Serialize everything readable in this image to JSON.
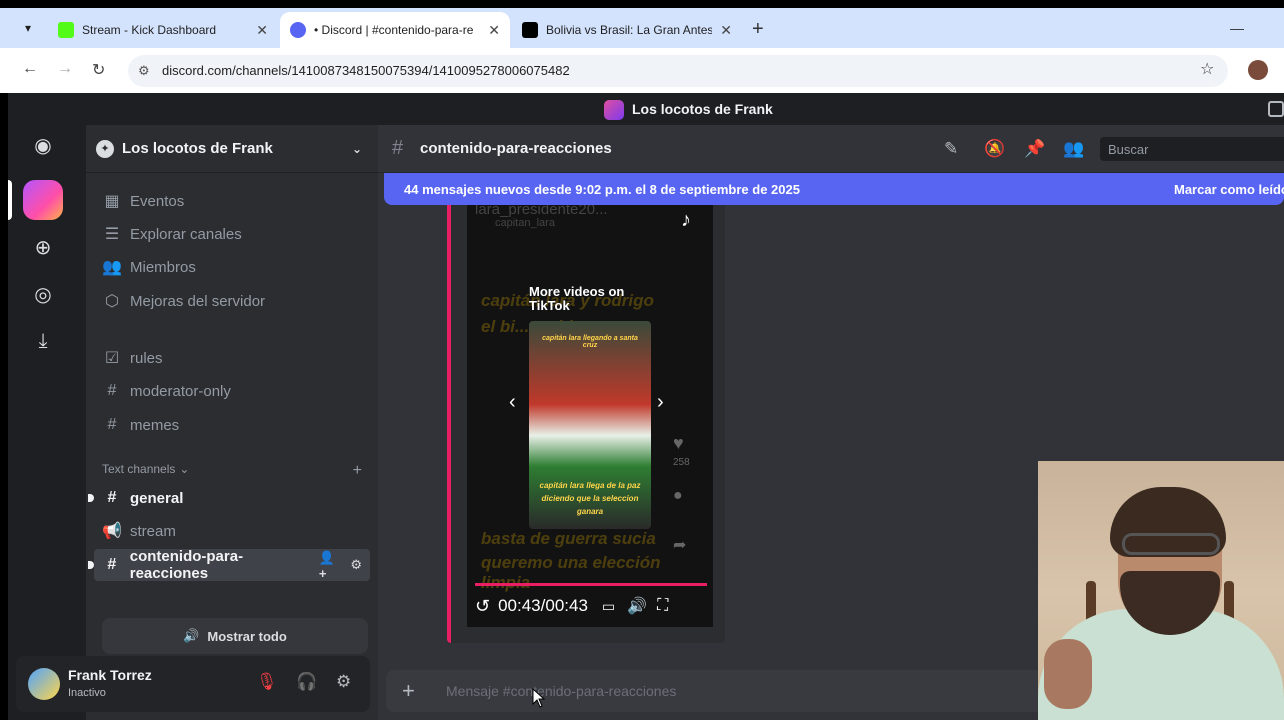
{
  "browser": {
    "tabs": [
      {
        "title": "Stream - Kick Dashboard",
        "color": "#53fc18"
      },
      {
        "title": "• Discord | #contenido-para-re",
        "color": "#5865f2"
      },
      {
        "title": "Bolivia vs Brasil: La Gran Antesa",
        "color": "#000000"
      }
    ],
    "url": "discord.com/channels/1410087348150075394/1410095278006075482"
  },
  "discord": {
    "window_title": "Los locotos de Frank",
    "server": {
      "name": "Los locotos de Frank",
      "menu": [
        {
          "label": "Eventos",
          "icon": "calendar-icon"
        },
        {
          "label": "Explorar canales",
          "icon": "browse-channels-icon"
        },
        {
          "label": "Miembros",
          "icon": "members-icon"
        },
        {
          "label": "Mejoras del servidor",
          "icon": "boost-icon"
        }
      ],
      "channels_top": [
        {
          "label": "rules",
          "icon": "rules-icon"
        },
        {
          "label": "moderator-only",
          "icon": "hash-icon"
        },
        {
          "label": "memes",
          "icon": "hash-icon"
        }
      ],
      "category": "Text channels",
      "text_channels": [
        {
          "label": "general",
          "icon": "hash-icon"
        },
        {
          "label": "stream",
          "icon": "megaphone-icon"
        },
        {
          "label": "contenido-para-reacciones",
          "icon": "hash-icon"
        }
      ],
      "show_all": "Mostrar todo"
    },
    "user": {
      "name": "Frank Torrez",
      "status": "Inactivo"
    },
    "channel": {
      "name": "contenido-para-reacciones",
      "search_placeholder": "Buscar",
      "banner_text": "44 mensajes nuevos desde 9:02 p.m. el 8 de septiembre de 2025",
      "banner_action": "Marcar como leído",
      "compose_placeholder": "Mensaje #contenido-para-reacciones"
    },
    "embed": {
      "watermark": "lara_presidente20...",
      "handle": "capitan_lara",
      "more_videos": "More videos on TikTok",
      "caption_top": "capitán lara llegando a santa cruz",
      "caption_bottom": "capitán lara llega de la paz diciendo que la seleccion ganara",
      "bg_line1": "capitán lara y rodrigo",
      "bg_line2": "el bi... ...ablo",
      "bg_line3": "basta de guerra sucia",
      "bg_line4": "queremo una elección limpia",
      "side_count": "258",
      "time": "00:43/00:43",
      "progress": 1.0
    }
  }
}
